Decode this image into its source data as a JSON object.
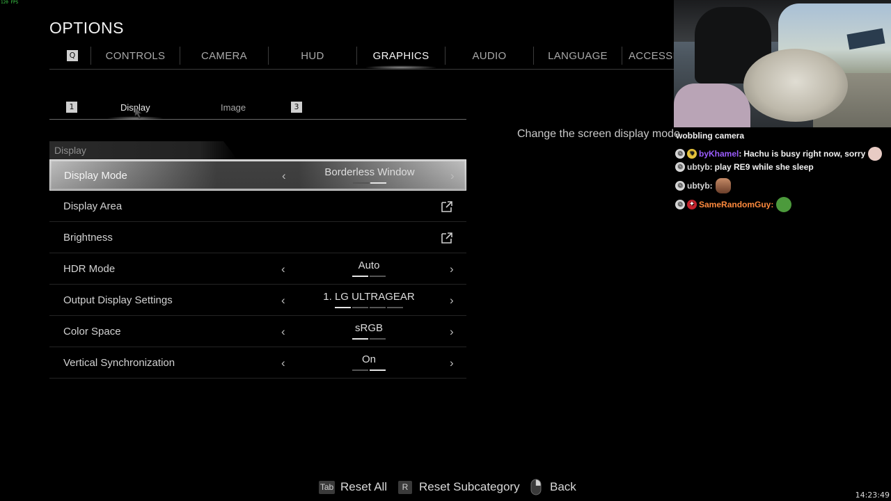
{
  "overlay": {
    "fps": "120 FPS",
    "clock": "14:23:49"
  },
  "title": "OPTIONS",
  "top_tabs": {
    "left_key": "Q",
    "items": [
      {
        "label": "CONTROLS"
      },
      {
        "label": "CAMERA"
      },
      {
        "label": "HUD"
      },
      {
        "label": "GRAPHICS",
        "active": true
      },
      {
        "label": "AUDIO"
      },
      {
        "label": "LANGUAGE"
      },
      {
        "label": "ACCESSI"
      }
    ]
  },
  "sub_tabs": {
    "left_key": "1",
    "right_key": "3",
    "items": [
      {
        "label": "Display",
        "active": true
      },
      {
        "label": "Image"
      }
    ]
  },
  "section": {
    "title": "Display"
  },
  "settings": [
    {
      "label": "Display Mode",
      "type": "selector",
      "value": "Borderless Window",
      "options_count": 2,
      "selected_index": 1,
      "selected": true
    },
    {
      "label": "Display Area",
      "type": "link",
      "icon": "external-link-icon"
    },
    {
      "label": "Brightness",
      "type": "link",
      "icon": "external-link-icon"
    },
    {
      "label": "HDR Mode",
      "type": "selector",
      "value": "Auto",
      "options_count": 2,
      "selected_index": 0
    },
    {
      "label": "Output Display Settings",
      "type": "selector",
      "value": "1. LG ULTRAGEAR",
      "options_count": 4,
      "selected_index": 0
    },
    {
      "label": "Color Space",
      "type": "selector",
      "value": "sRGB",
      "options_count": 2,
      "selected_index": 0
    },
    {
      "label": "Vertical Synchronization",
      "type": "selector",
      "value": "On",
      "options_count": 2,
      "selected_index": 1
    }
  ],
  "description": "Change the screen display mode.",
  "stream_chat": {
    "event": "wobbling camera",
    "messages": [
      {
        "user": "byKhamel",
        "user_color": "#9b5cff",
        "text": "Hachu is busy right now, sorry"
      },
      {
        "user": "ubtyb",
        "user_color": "#d6d6d6",
        "text": "play RE9 while she sleep"
      },
      {
        "user": "ubtyb",
        "user_color": "#d6d6d6",
        "text": ""
      },
      {
        "user": "SameRandomGuy",
        "user_color": "#ff8a3d",
        "text": ""
      }
    ]
  },
  "bottom_hints": [
    {
      "key": "Tab",
      "label": "Reset All"
    },
    {
      "key": "R",
      "label": "Reset Subcategory"
    },
    {
      "key": "mouse-right-icon",
      "label": "Back"
    }
  ],
  "colors": {
    "background": "#000000",
    "text_active": "#f5f5f5",
    "text_inactive": "#a9a9a9",
    "selected_row": "#bdbdbd"
  }
}
